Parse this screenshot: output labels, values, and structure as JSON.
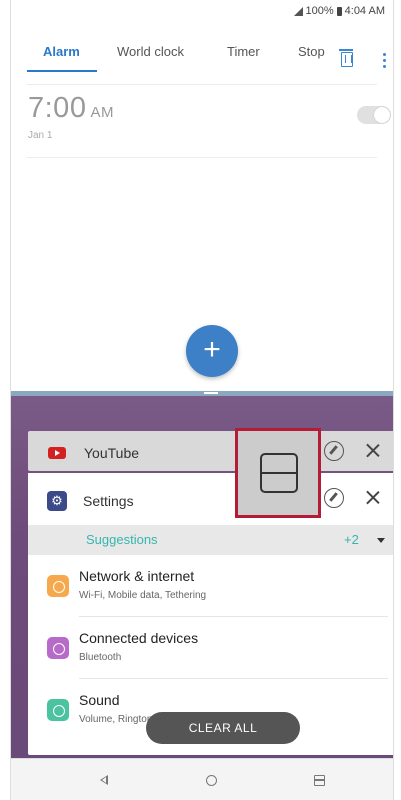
{
  "status_bar": {
    "battery": "100%",
    "time": "4:04 AM"
  },
  "clock_app": {
    "tabs": [
      {
        "label": "Alarm",
        "active": true
      },
      {
        "label": "World clock",
        "active": false
      },
      {
        "label": "Timer",
        "active": false
      },
      {
        "label": "Stop",
        "active": false
      }
    ],
    "alarm": {
      "time": "7:00",
      "ampm": "AM",
      "date": "Jan 1",
      "enabled": false
    },
    "fab_label": "+"
  },
  "recents": {
    "youtube_card": {
      "title": "YouTube"
    },
    "settings_card": {
      "title": "Settings",
      "suggestions": {
        "label": "Suggestions",
        "count": "+2"
      },
      "items": [
        {
          "title": "Network & internet",
          "subtitle": "Wi-Fi, Mobile data, Tethering",
          "icon": "wifi-icon"
        },
        {
          "title": "Connected devices",
          "subtitle": "Bluetooth",
          "icon": "share-icon"
        },
        {
          "title": "Sound",
          "subtitle": "Volume, Ringtone, Notification sound",
          "icon": "volume-icon"
        }
      ]
    },
    "clear_all_label": "CLEAR ALL"
  },
  "colors": {
    "accent": "#2a78c8",
    "fab": "#3d80c7",
    "highlight_border": "#b21c37",
    "suggestion_teal": "#35b6ad"
  }
}
